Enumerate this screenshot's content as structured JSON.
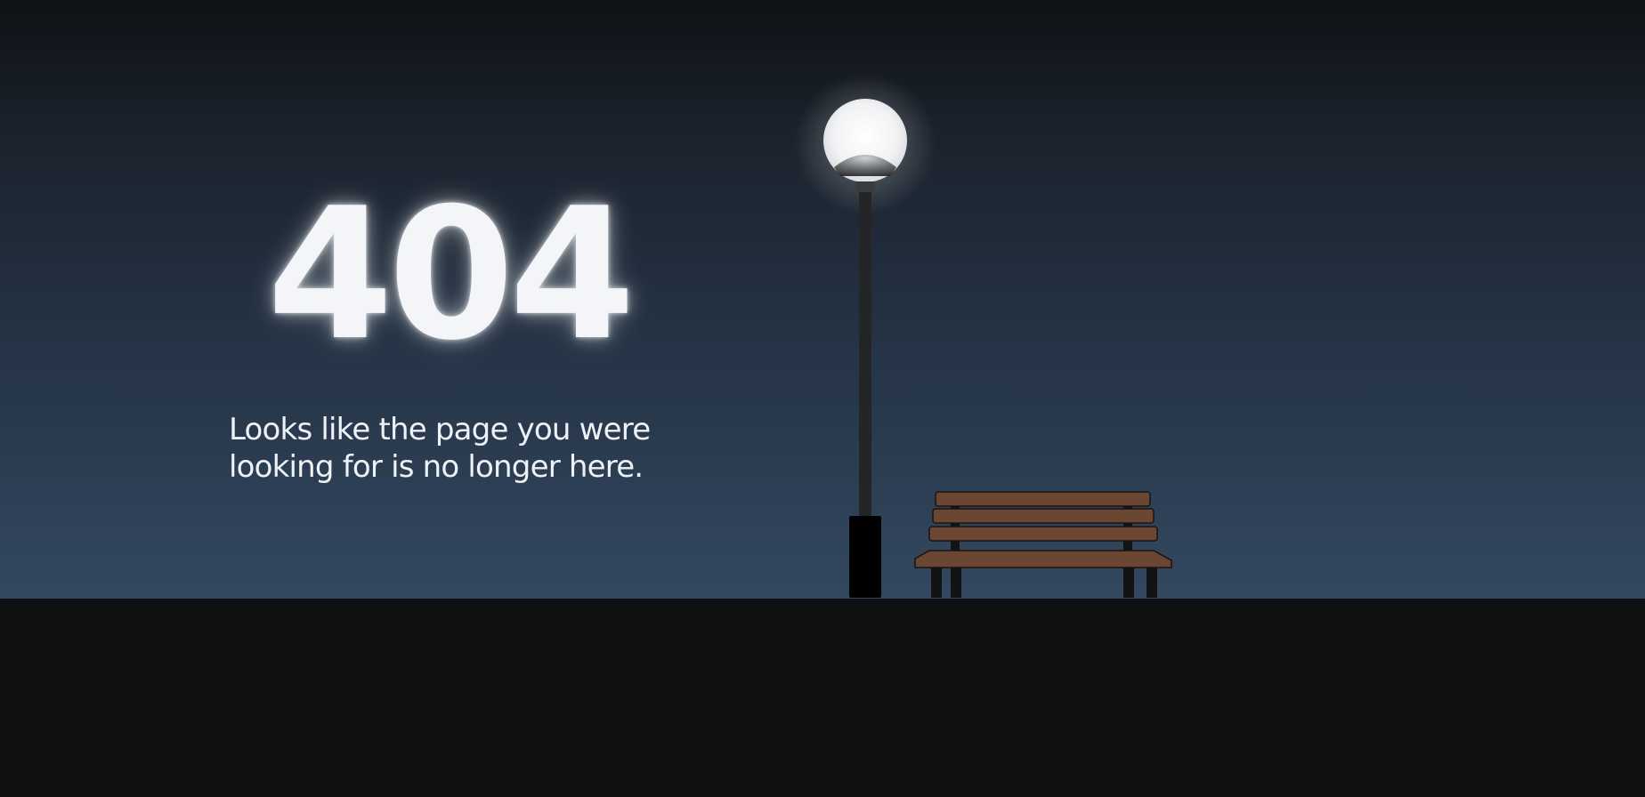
{
  "error": {
    "code": "404",
    "message": "Looks like the page you were looking for is no longer here."
  },
  "illustration": {
    "lamp": "street-lamp",
    "bench": "park-bench"
  },
  "colors": {
    "sky_top": "#0f1216",
    "sky_bottom": "#33485f",
    "ground": "#0e1012",
    "text": "#f3f5f9",
    "bench_wood": "#6b4632",
    "lamp_post": "#222426"
  }
}
